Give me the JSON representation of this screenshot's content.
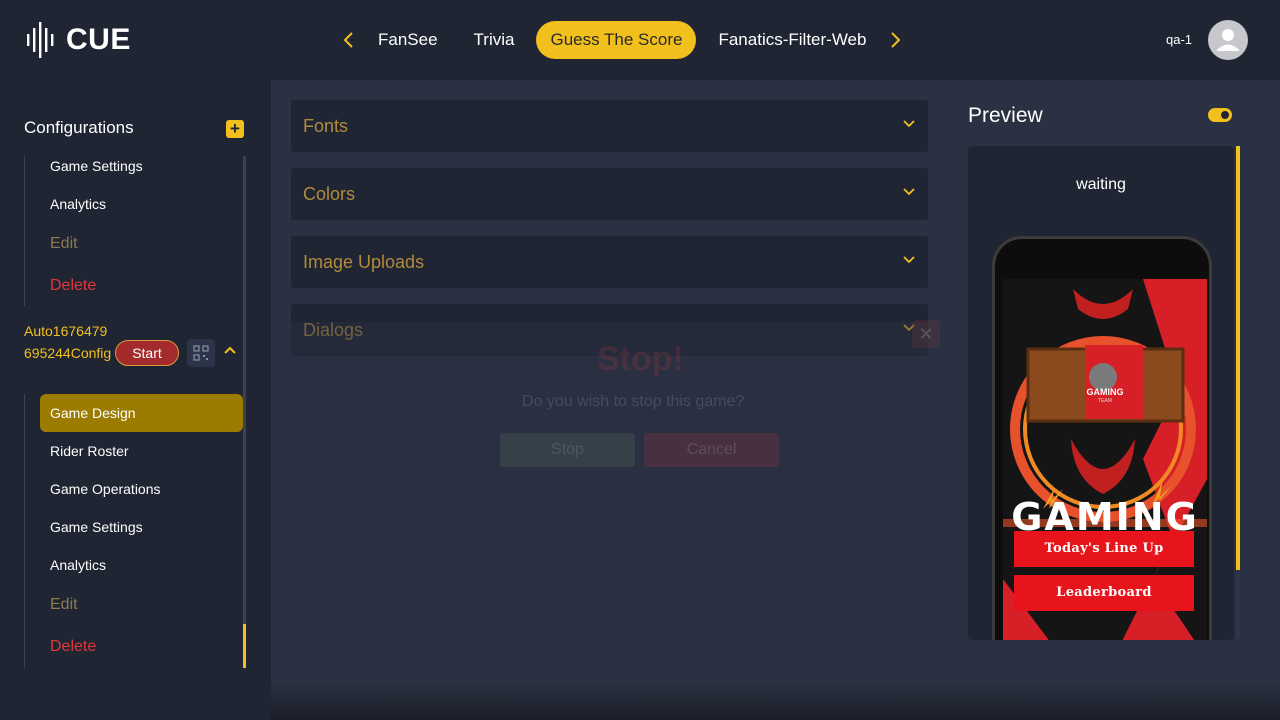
{
  "brand": {
    "name": "CUE"
  },
  "nav": {
    "tabs": [
      {
        "label": "FanSee"
      },
      {
        "label": "Trivia"
      },
      {
        "label": "Guess The Score",
        "active": true
      },
      {
        "label": "Fanatics-Filter-Web"
      }
    ]
  },
  "user": {
    "name": "qa-1"
  },
  "sidebar": {
    "title": "Configurations",
    "top_items": [
      {
        "label": "Game Settings"
      },
      {
        "label": "Analytics"
      },
      {
        "label": "Edit"
      },
      {
        "label": "Delete"
      }
    ],
    "config": {
      "name": "Auto1676479695244Config",
      "start_label": "Start"
    },
    "config_items": [
      {
        "label": "Game Design"
      },
      {
        "label": "Rider Roster"
      },
      {
        "label": "Game Operations"
      },
      {
        "label": "Game Settings"
      },
      {
        "label": "Analytics"
      },
      {
        "label": "Edit"
      },
      {
        "label": "Delete"
      }
    ]
  },
  "sections": [
    {
      "label": "Fonts"
    },
    {
      "label": "Colors"
    },
    {
      "label": "Image Uploads"
    },
    {
      "label": "Dialogs"
    }
  ],
  "dialog": {
    "title": "Stop!",
    "message": "Do you wish to stop this game?",
    "confirm_label": "Stop",
    "cancel_label": "Cancel"
  },
  "preview": {
    "title": "Preview",
    "status": "waiting",
    "enabled": true,
    "logo_text": "GAMING",
    "logo_subtext": "TEAM",
    "headline": "GAMING",
    "buttons": [
      {
        "label": "Today's Line Up"
      },
      {
        "label": "Leaderboard"
      }
    ]
  },
  "colors": {
    "accent": "#f2c01d",
    "danger": "#e2383a",
    "background": "#1f2533",
    "panel": "#2a3142"
  }
}
